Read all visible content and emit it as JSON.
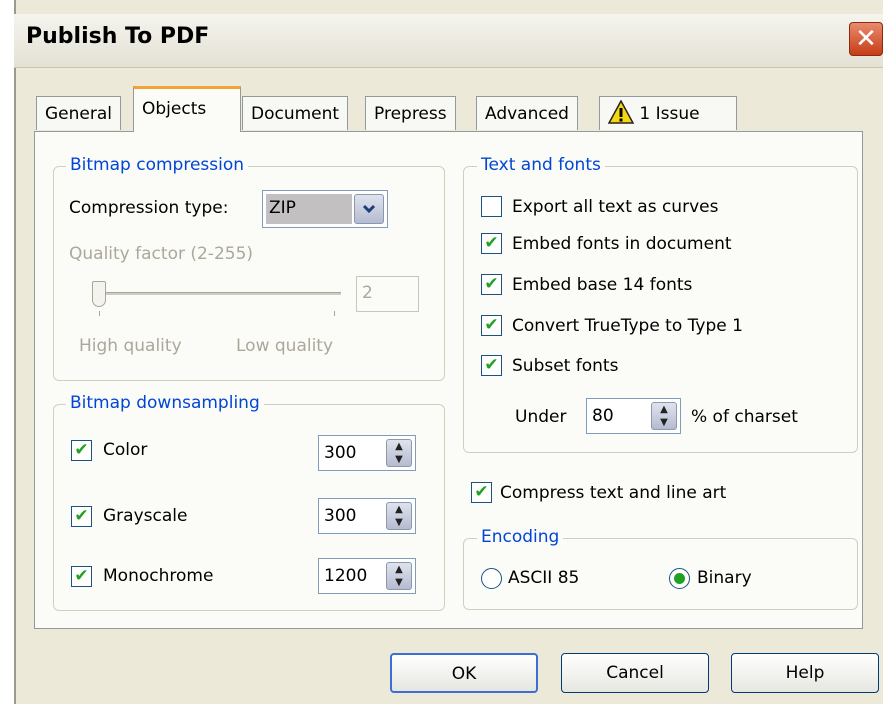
{
  "window": {
    "title": "Publish To PDF",
    "close_symbol": "✕"
  },
  "tabs": [
    {
      "label": "General"
    },
    {
      "label": "Objects"
    },
    {
      "label": "Document"
    },
    {
      "label": "Prepress"
    },
    {
      "label": "Advanced"
    },
    {
      "label": "1 Issue",
      "icon": "warning-icon"
    }
  ],
  "bitmap_compression": {
    "title": "Bitmap compression",
    "compression_label": "Compression type:",
    "compression_value": "ZIP",
    "quality_label": "Quality factor (2-255)",
    "quality_value": "2",
    "high_label": "High quality",
    "low_label": "Low quality"
  },
  "bitmap_downsampling": {
    "title": "Bitmap downsampling",
    "rows": [
      {
        "label": "Color",
        "checked": true,
        "value": "300"
      },
      {
        "label": "Grayscale",
        "checked": true,
        "value": "300"
      },
      {
        "label": "Monochrome",
        "checked": true,
        "value": "1200"
      }
    ]
  },
  "text_fonts": {
    "title": "Text and fonts",
    "options": [
      {
        "label": "Export all text as curves",
        "checked": false
      },
      {
        "label": "Embed fonts in document",
        "checked": true
      },
      {
        "label": "Embed base 14 fonts",
        "checked": true
      },
      {
        "label": "Convert TrueType to Type 1",
        "checked": true
      },
      {
        "label": "Subset fonts",
        "checked": true
      }
    ],
    "under_label": "Under",
    "under_value": "80",
    "charset_label": "% of charset"
  },
  "compress": {
    "label": "Compress text and line art",
    "checked": true
  },
  "encoding": {
    "title": "Encoding",
    "options": [
      {
        "label": "ASCII 85",
        "selected": false
      },
      {
        "label": "Binary",
        "selected": true
      }
    ]
  },
  "buttons": {
    "ok": "OK",
    "cancel": "Cancel",
    "help": "Help"
  },
  "check_symbol": "✔",
  "colors": {
    "legend": "#0046d5",
    "check": "#21a121",
    "active_tab": "#f3a33a"
  }
}
